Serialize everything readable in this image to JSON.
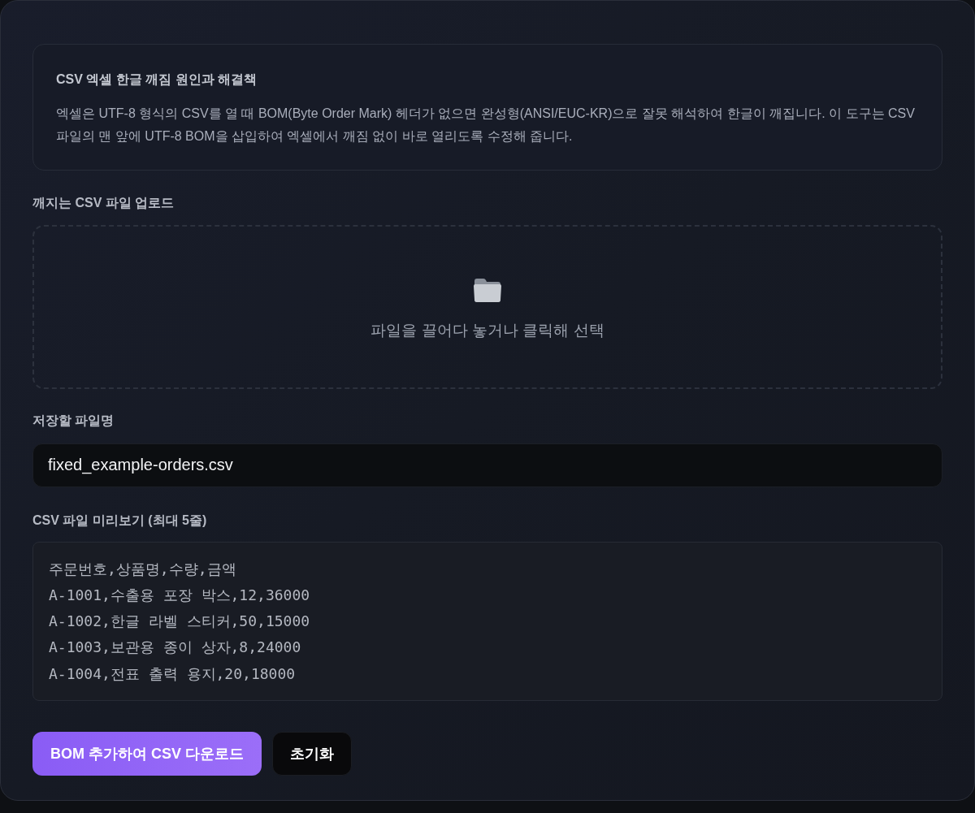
{
  "info": {
    "title": "CSV 엑셀 한글 깨짐 원인과 해결책",
    "body": "엑셀은 UTF-8 형식의 CSV를 열 때 BOM(Byte Order Mark) 헤더가 없으면 완성형(ANSI/EUC-KR)으로 잘못 해석하여 한글이 깨집니다. 이 도구는 CSV 파일의 맨 앞에 UTF-8 BOM을 삽입하여 엑셀에서 깨짐 없이 바로 열리도록 수정해 줍니다."
  },
  "upload": {
    "label": "깨지는 CSV 파일 업로드",
    "prompt": "파일을 끌어다 놓거나 클릭해 선택"
  },
  "filename": {
    "label": "저장할 파일명",
    "value": "fixed_example-orders.csv"
  },
  "preview": {
    "label": "CSV 파일 미리보기 (최대 5줄)",
    "lines": [
      "주문번호,상품명,수량,금액",
      "A-1001,수출용 포장 박스,12,36000",
      "A-1002,한글 라벨 스티커,50,15000",
      "A-1003,보관용 종이 상자,8,24000",
      "A-1004,전표 출력 용지,20,18000"
    ]
  },
  "buttons": [
    {
      "label": "BOM 추가하여 CSV 다운로드",
      "kind": "primary"
    },
    {
      "label": "초기화",
      "kind": "secondary"
    }
  ]
}
